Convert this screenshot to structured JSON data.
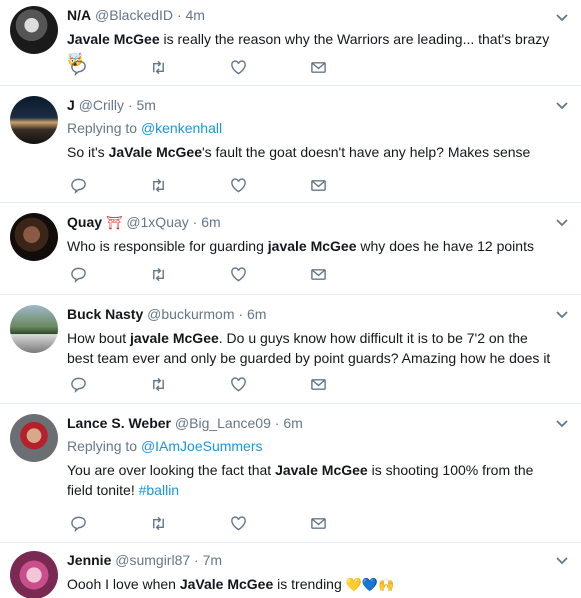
{
  "tweets": [
    {
      "name": "N/A",
      "handle": "@BlackedID",
      "time": "4m",
      "text_before": "",
      "bold": "Javale McGee",
      "text_after": " is really the reason why the Warriors are leading... that's brazy ",
      "emoji": "🤯"
    },
    {
      "name": "J",
      "handle": "@Crilly",
      "time": "5m",
      "reply_prefix": "Replying to ",
      "reply_to": "@kenkenhall",
      "text_before": "So it's ",
      "bold": "JaVale McGee",
      "text_after": "'s fault the goat doesn't have any help? Makes sense"
    },
    {
      "name": "Quay",
      "name_emoji": "⛩",
      "handle": "@1xQuay",
      "time": "6m",
      "text_before": "Who is responsible for guarding ",
      "bold": "javale McGee",
      "text_after": " why does he have 12 points"
    },
    {
      "name": "Buck Nasty",
      "handle": "@buckurmom",
      "time": "6m",
      "text_before": "How bout ",
      "bold": "javale McGee",
      "text_after": ". Do u guys know how difficult it is to be 7'2 on the best team ever and only be guarded by point guards? Amazing how he does it"
    },
    {
      "name": "Lance S. Weber",
      "handle": "@Big_Lance09",
      "time": "6m",
      "reply_prefix": "Replying to ",
      "reply_to": "@IAmJoeSummers",
      "text_before": "You are over looking the fact that ",
      "bold": "Javale McGee",
      "text_after": " is shooting 100% from the field tonite! ",
      "hashtag": "#ballin"
    },
    {
      "name": "Jennie",
      "handle": "@sumgirl87",
      "time": "7m",
      "text_before": "Oooh I love when ",
      "bold": "JaVale McGee",
      "text_after": " is trending ",
      "emoji": "💛💙🙌"
    }
  ],
  "separator": "·",
  "colors": {
    "link": "#1b95e0",
    "secondary": "#657786",
    "icon": "#657786",
    "divider": "#e6ecf0"
  },
  "icons": [
    "reply-icon",
    "retweet-icon",
    "like-icon",
    "message-icon",
    "chevron-down-icon"
  ]
}
